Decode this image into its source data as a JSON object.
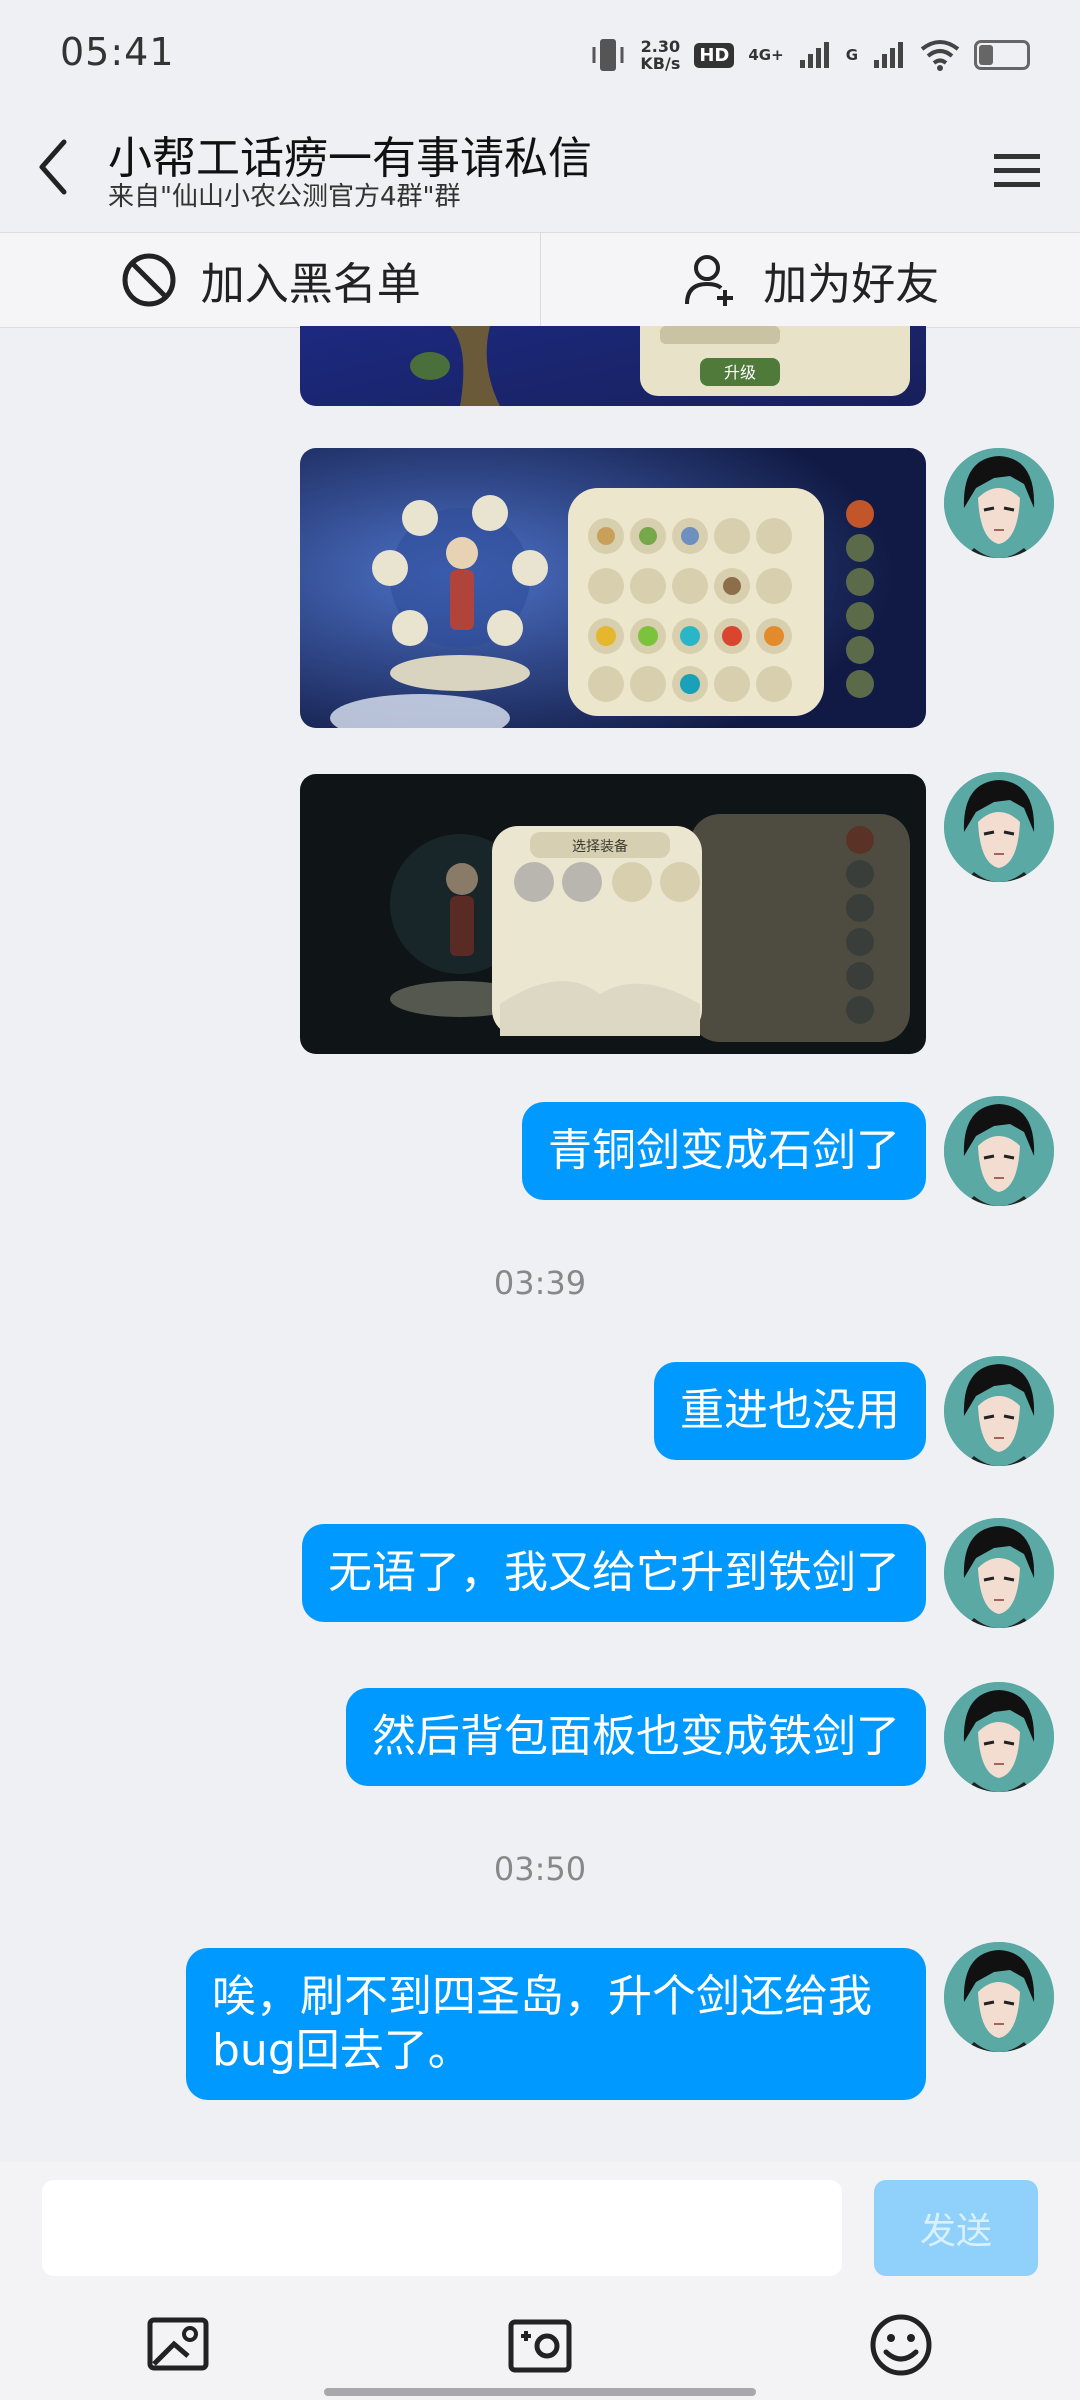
{
  "status_bar": {
    "time": "05:41",
    "net_speed_value": "2.30",
    "net_speed_unit": "KB/s",
    "hd_badge": "HD",
    "network_1": "4G+",
    "network_2": "G"
  },
  "header": {
    "title": "小帮工话痨一有事请私信",
    "subtitle": "来自\"仙山小农公测官方4群\"群"
  },
  "actions": {
    "blacklist_label": "加入黑名单",
    "add_friend_label": "加为好友"
  },
  "messages": {
    "img_game_upgrade_label": "升级",
    "img_game_equip_title": "选择装备",
    "msg1": "青铜剑变成石剑了",
    "time1": "03:39",
    "msg2": "重进也没用",
    "msg3": "无语了，我又给它升到铁剑了",
    "msg4": "然后背包面板也变成铁剑了",
    "time2": "03:50",
    "msg5": "唉，刷不到四圣岛，升个剑还给我bug回去了。"
  },
  "input": {
    "send_label": "发送"
  },
  "colors": {
    "bubble": "#0099ff",
    "background": "#eff0f4",
    "send_disabled": "#8fd1fb"
  }
}
